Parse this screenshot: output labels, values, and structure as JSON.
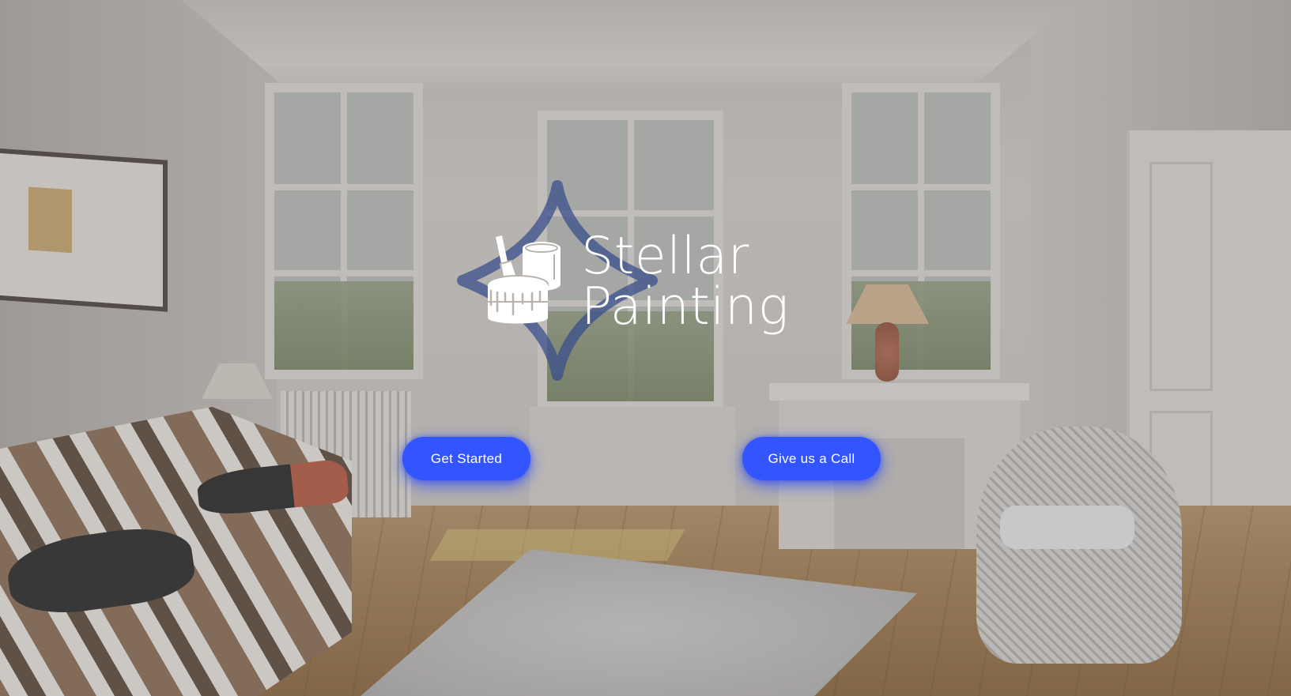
{
  "brand": {
    "line1": "Stellar",
    "line2": "Painting",
    "logo_icon": "paint-can-brush-icon",
    "star_icon": "four-point-star-icon",
    "star_color": "#3a4f8c",
    "text_color": "#ffffff"
  },
  "actions": {
    "get_started_label": "Get Started",
    "call_label": "Give us a Call",
    "button_color": "#3355ff"
  },
  "background": {
    "description_icon": "living-room-background-image"
  }
}
